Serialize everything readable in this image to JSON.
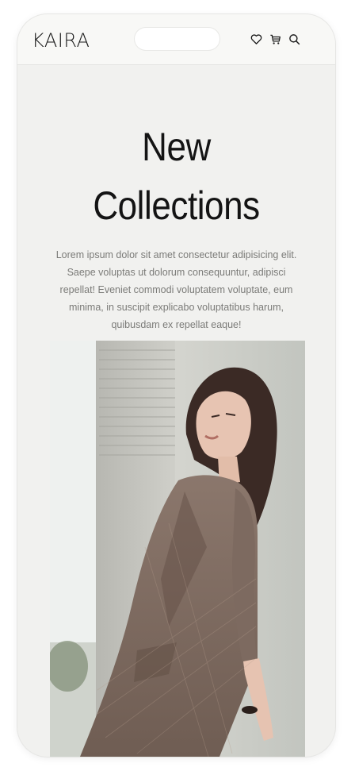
{
  "header": {
    "logo": "KAIRA",
    "icons": [
      "heart-icon",
      "cart-icon",
      "search-icon"
    ]
  },
  "hero": {
    "title_line1": "New",
    "title_line2": "Collections",
    "description": "Lorem ipsum dolor sit amet consectetur adipisicing elit. Saepe voluptas ut dolorum consequuntur, adipisci repellat! Eveniet commodi voluptatem voluptate, eum minima, in suscipit explicabo voluptatibus harum, quibusdam ex repellat eaque!"
  },
  "colors": {
    "background": "#f1f1ef",
    "text_dark": "#141414",
    "text_muted": "#7b7b78"
  }
}
